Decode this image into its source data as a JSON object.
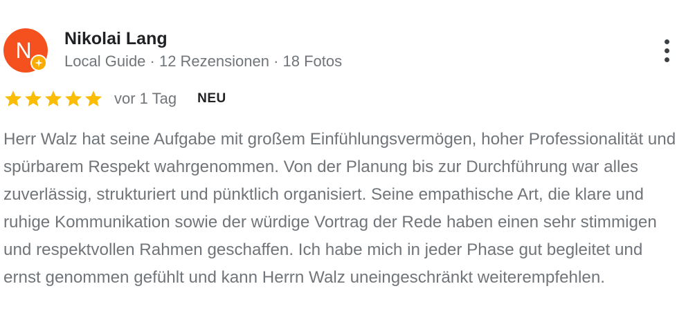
{
  "author": {
    "initial": "N",
    "name": "Nikolai Lang",
    "meta": "Local Guide · 12 Rezensionen · 18 Fotos"
  },
  "icons": {
    "avatar_badge": "local-guide-star-icon",
    "more": "more-vertical-icon",
    "star": "star-icon"
  },
  "colors": {
    "avatar": "#f4511e",
    "guide_badge": "#f9ab00",
    "star": "#fbbc04",
    "meta_text": "#70757a",
    "name_text": "#202124"
  },
  "rating": {
    "stars": 5,
    "max": 5
  },
  "time": "vor 1 Tag",
  "badge": "NEU",
  "review_text": "Herr Walz hat seine Aufgabe mit großem Einfühlungsvermögen, hoher Professionalität und spürbarem Respekt wahrgenommen. Von der Planung bis zur Durchführung war alles zuverlässig, strukturiert und pünktlich organisiert. Seine empathische Art, die klare und ruhige Kommunikation sowie der würdige Vortrag der Rede haben einen sehr stimmigen und respektvollen Rahmen geschaffen. Ich habe mich in jeder Phase gut begleitet und ernst genommen gefühlt und kann Herrn Walz uneingeschränkt weiterempfehlen."
}
